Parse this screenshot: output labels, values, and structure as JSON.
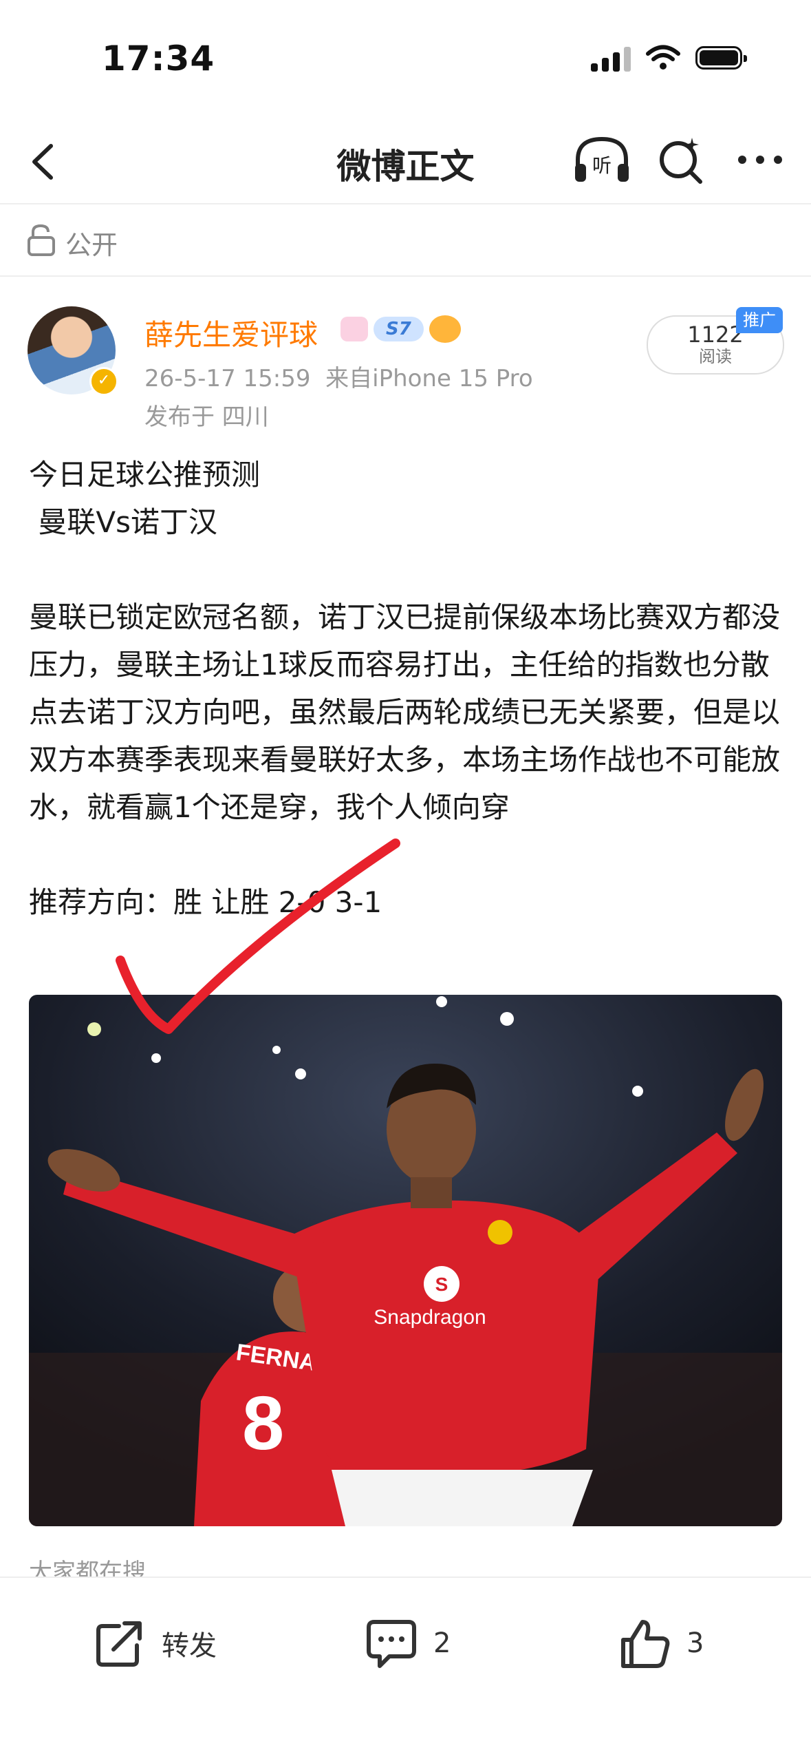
{
  "status_bar": {
    "time": "17:34"
  },
  "nav": {
    "title": "微博正文",
    "listen_label": "听"
  },
  "privacy": {
    "label": "公开"
  },
  "author": {
    "name": "薛先生爱评球",
    "badge_level": "S7",
    "timestamp": "26-5-17 15:59",
    "source": "来自iPhone 15 Pro",
    "location": "发布于 四川"
  },
  "reads": {
    "count": "1122",
    "unit": "阅读",
    "promo_tag": "推广"
  },
  "post": {
    "line1": "今日足球公推预测",
    "line2": " 曼联Vs诺丁汉",
    "body": "曼联已锁定欧冠名额，诺丁汉已提前保级本场比赛双方都没压力，曼联主场让1球反而容易打出，主任给的指数也分散点去诺丁汉方向吧，虽然最后两轮成绩已无关紧要，但是以双方本赛季表现来看曼联好太多，本场主场作战也不可能放水，就看赢1个还是穿，我个人倾向穿",
    "recommendation": "推荐方向：胜 让胜 2-0 3-1"
  },
  "photo": {
    "shirt_text_main": "Snapdragon",
    "back_name": "FERNANDES",
    "back_number": "8"
  },
  "search_hint": "大家都在搜",
  "actions": {
    "repost": "转发",
    "comments": "2",
    "likes": "3"
  },
  "colors": {
    "author": "#ff7a00",
    "shirt": "#d8202a",
    "accent": "#3e8ef7"
  }
}
